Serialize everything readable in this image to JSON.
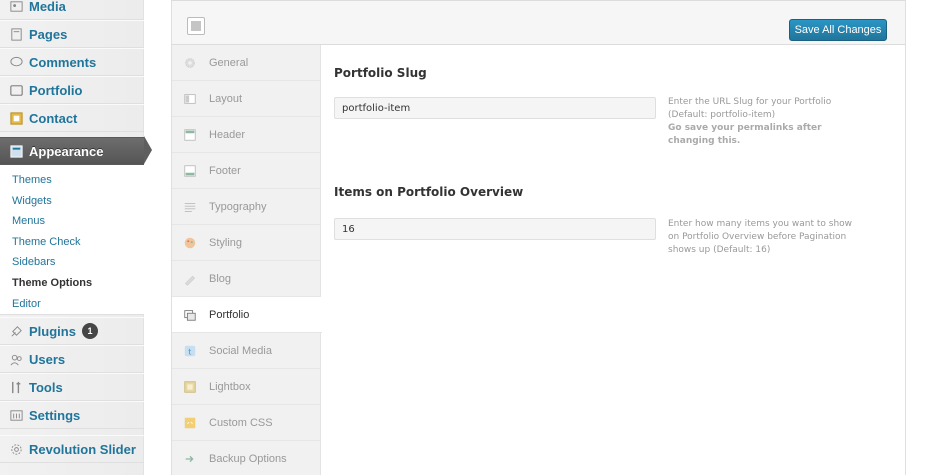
{
  "sidebar": {
    "menu": [
      {
        "label": "Media",
        "icon": "media-icon"
      },
      {
        "label": "Pages",
        "icon": "pages-icon"
      },
      {
        "label": "Comments",
        "icon": "comments-icon"
      },
      {
        "label": "Portfolio",
        "icon": "portfolio-icon"
      },
      {
        "label": "Contact",
        "icon": "contact-icon"
      },
      {
        "label": "Appearance",
        "icon": "appearance-icon"
      },
      {
        "label": "Plugins",
        "icon": "plugins-icon",
        "badge": "1"
      },
      {
        "label": "Users",
        "icon": "users-icon"
      },
      {
        "label": "Tools",
        "icon": "tools-icon"
      },
      {
        "label": "Settings",
        "icon": "settings-icon"
      },
      {
        "label": "Revolution Slider",
        "icon": "revolution-slider-icon"
      }
    ],
    "appearance_submenu": [
      "Themes",
      "Widgets",
      "Menus",
      "Theme Check",
      "Sidebars",
      "Theme Options",
      "Editor"
    ],
    "current_submenu": "Theme Options"
  },
  "toolbar": {
    "save_label": "Save All Changes"
  },
  "tabs": [
    {
      "label": "General",
      "icon": "gear-icon"
    },
    {
      "label": "Layout",
      "icon": "layout-icon"
    },
    {
      "label": "Header",
      "icon": "header-icon"
    },
    {
      "label": "Footer",
      "icon": "footer-icon"
    },
    {
      "label": "Typography",
      "icon": "typography-icon"
    },
    {
      "label": "Styling",
      "icon": "styling-icon"
    },
    {
      "label": "Blog",
      "icon": "blog-icon"
    },
    {
      "label": "Portfolio",
      "icon": "portfolio-tab-icon"
    },
    {
      "label": "Social Media",
      "icon": "social-media-icon"
    },
    {
      "label": "Lightbox",
      "icon": "lightbox-icon"
    },
    {
      "label": "Custom CSS",
      "icon": "css-icon"
    },
    {
      "label": "Backup Options",
      "icon": "backup-icon"
    }
  ],
  "active_tab": "Portfolio",
  "sections": {
    "slug": {
      "title": "Portfolio Slug",
      "value": "portfolio-item",
      "desc_line1": "Enter the URL Slug for your Portfolio",
      "desc_line2": "(Default: portfolio-item)",
      "desc_bold1": "Go save your permalinks after",
      "desc_bold2": "changing this."
    },
    "items": {
      "title": "Items on Portfolio Overview",
      "value": "16",
      "desc_line1": "Enter how many items you want to show",
      "desc_line2": "on Portfolio Overview before Pagination",
      "desc_line3": "shows up (Default: 16)"
    }
  },
  "colors": {
    "link": "#21759b",
    "button": "#21759b",
    "current_menu": "#5e5e5e"
  }
}
